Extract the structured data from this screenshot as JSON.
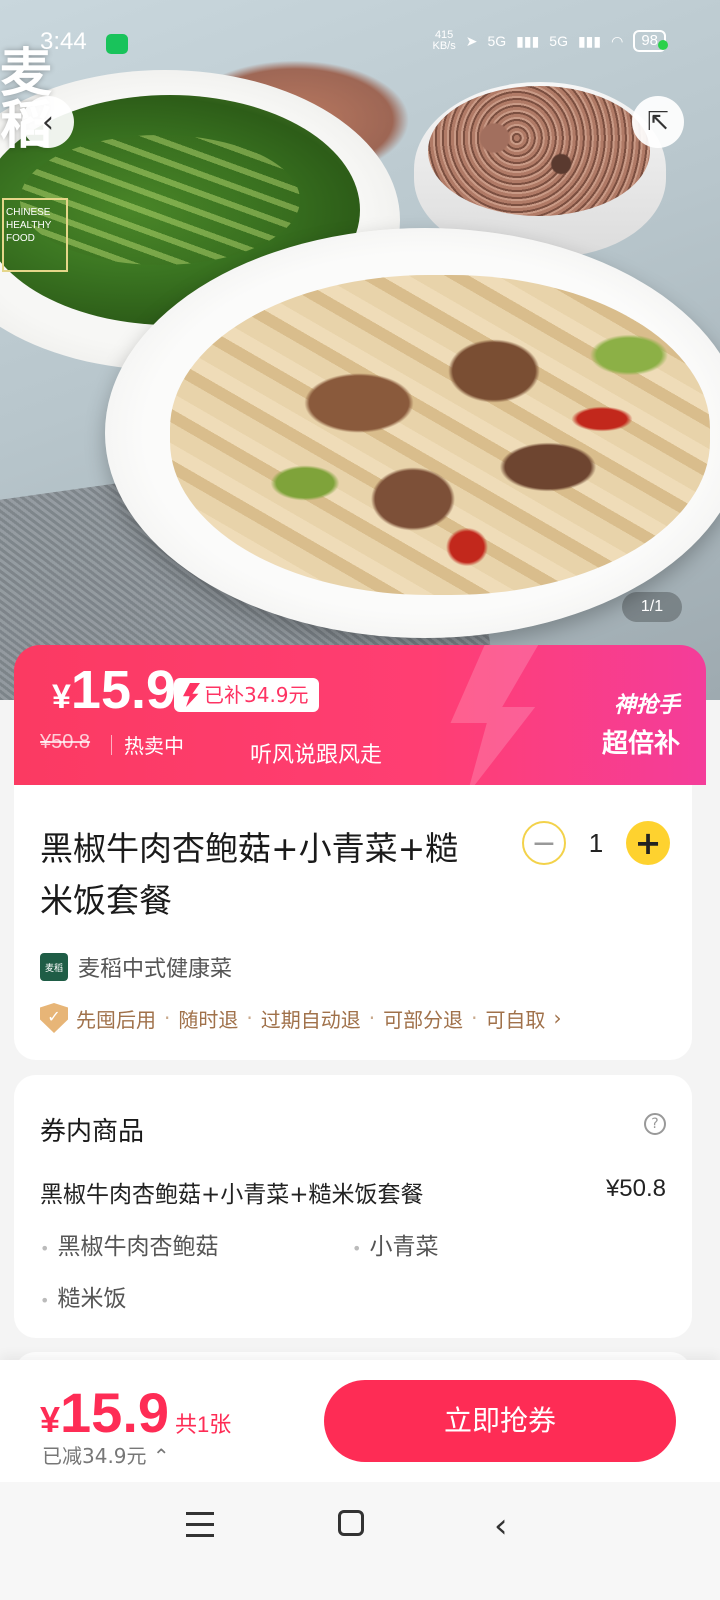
{
  "status_bar": {
    "time": "3:44",
    "net_speed_value": "415",
    "net_speed_unit": "KB/s",
    "signal_1": "5G",
    "signal_2": "5G",
    "battery": "98"
  },
  "hero": {
    "brand_char": "麦\n稻",
    "brand_box": "CHINESE HEALTHY FOOD",
    "image_counter": "1/1",
    "back_icon": "chevron-left-icon",
    "share_icon": "share-icon"
  },
  "price_banner": {
    "currency": "¥",
    "price": "15.9",
    "subsidy": "已补34.9元",
    "original_price": "¥50.8",
    "hot_text": "热卖中",
    "slogan": "听风说跟风走",
    "badge_line1": "神抢手",
    "badge_line2": "超倍补"
  },
  "product": {
    "title": "黑椒牛肉杏鲍菇+小青菜+糙米饭套餐",
    "quantity": "1",
    "shop_logo": "麦稻",
    "shop_name": "麦稻中式健康菜",
    "guarantees": [
      "先囤后用",
      "随时退",
      "过期自动退",
      "可部分退",
      "可自取"
    ],
    "guarantee_more": "›"
  },
  "voucher": {
    "title": "券内商品",
    "item_name": "黑椒牛肉杏鲍菇+小青菜+糙米饭套餐",
    "item_price": "¥50.8",
    "sub_items": [
      "黑椒牛肉杏鲍菇",
      "小青菜",
      "糙米饭"
    ]
  },
  "bottom_bar": {
    "currency": "¥",
    "price": "15.9",
    "count": "共1张",
    "saved": "已减34.9元 ⌃",
    "buy_label": "立即抢券"
  },
  "colors": {
    "accent": "#fe2c55",
    "banner_start": "#fb3a62",
    "banner_end": "#f43d9a",
    "stepper_yellow": "#fed22f",
    "guarantee_brown": "#a0714a"
  }
}
